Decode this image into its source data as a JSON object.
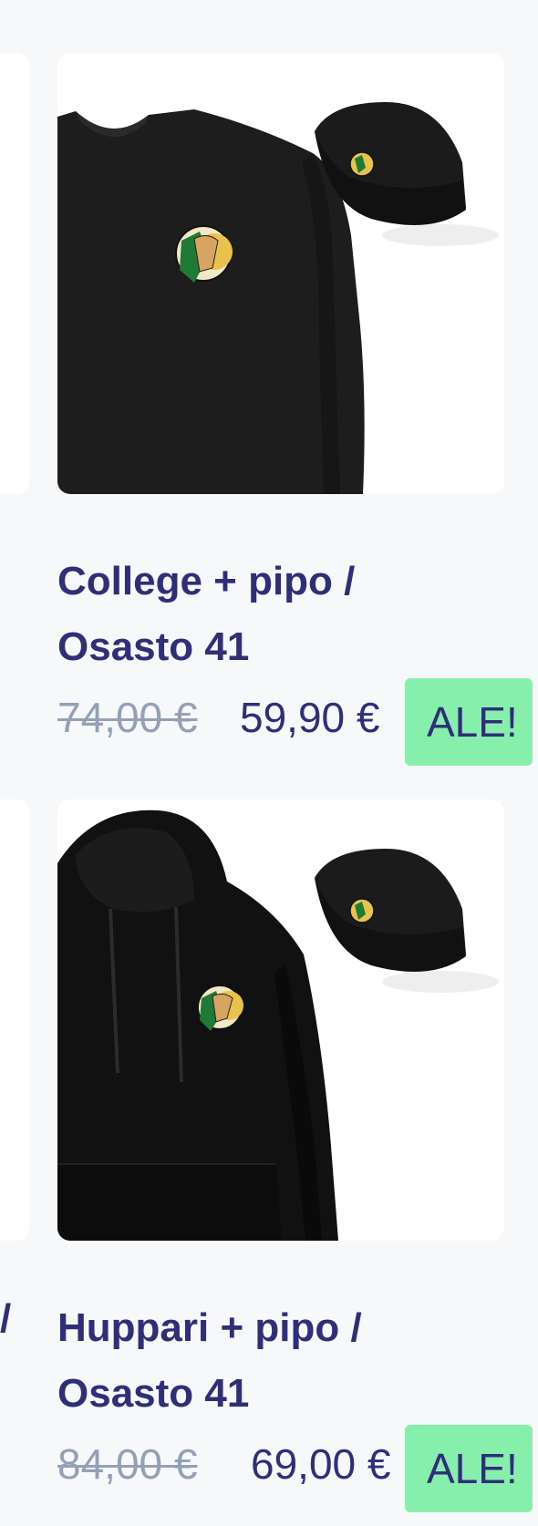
{
  "products": [
    {
      "title": "College + pipo / Osasto 41",
      "price_old": "74,00 €",
      "price_new": "59,90 €",
      "badge": "ALE!",
      "image_icon": "sweatshirt-beanie-image"
    },
    {
      "title": "Huppari + pipo / Osasto 41",
      "price_old": "84,00 €",
      "price_new": "69,00 €",
      "badge": "ALE!",
      "image_icon": "hoodie-beanie-image"
    }
  ],
  "prev_column": {
    "title_fragment": "/"
  },
  "colors": {
    "title": "#2e2f78",
    "old_price": "#93a0b6",
    "badge_bg": "#86efac",
    "background": "#f7f8fa"
  }
}
